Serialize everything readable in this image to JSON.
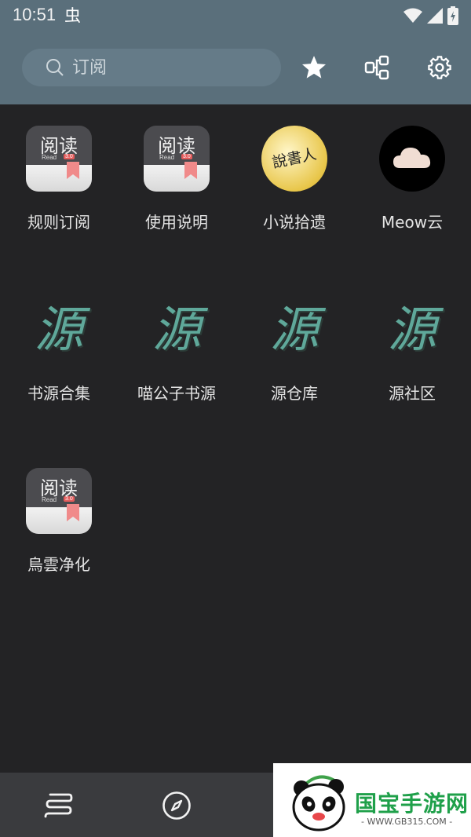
{
  "status": {
    "time": "10:51",
    "app_glyph": "虫"
  },
  "search": {
    "placeholder": "订阅"
  },
  "grid": {
    "items": [
      {
        "label": "规则订阅",
        "icon": "yuedu-app-icon",
        "icon_title": "阅读",
        "icon_sub": "Read",
        "icon_ver": "3.0"
      },
      {
        "label": "使用说明",
        "icon": "yuedu-app-icon",
        "icon_title": "阅读",
        "icon_sub": "Read",
        "icon_ver": "3.0"
      },
      {
        "label": "小说拾遗",
        "icon": "storyteller-icon",
        "icon_text": "說書人"
      },
      {
        "label": "Meow云",
        "icon": "cloud-icon"
      },
      {
        "label": "书源合集",
        "icon": "yuan-calligraphy-icon",
        "icon_text": "源"
      },
      {
        "label": "喵公子书源",
        "icon": "yuan-calligraphy-icon",
        "icon_text": "源"
      },
      {
        "label": "源仓库",
        "icon": "yuan-calligraphy-icon",
        "icon_text": "源"
      },
      {
        "label": "源社区",
        "icon": "yuan-calligraphy-icon",
        "icon_text": "源"
      },
      {
        "label": "烏雲净化",
        "icon": "yuedu-app-icon",
        "icon_title": "阅读",
        "icon_sub": "Read",
        "icon_ver": "3.0"
      }
    ]
  },
  "watermark": {
    "title": "国宝手游网",
    "sub": "- WWW.GB315.COM -"
  },
  "colors": {
    "header": "#5a6f7b",
    "background": "#232325",
    "nav": "#3a3b3e",
    "accent": "#1fa04a"
  }
}
